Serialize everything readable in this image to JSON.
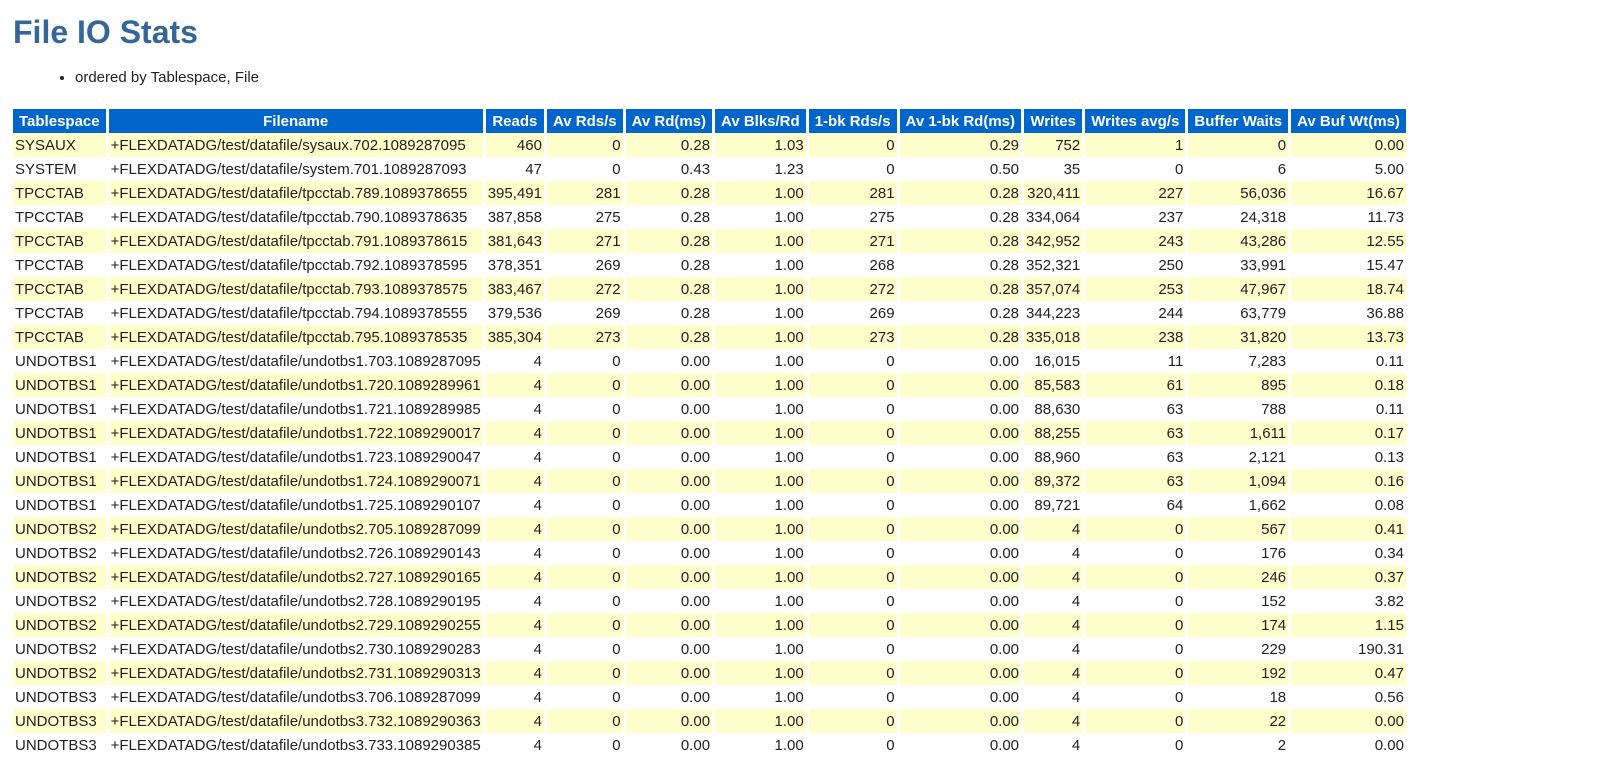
{
  "title": "File IO Stats",
  "notes": [
    "ordered by Tablespace, File"
  ],
  "columns": [
    "Tablespace",
    "Filename",
    "Reads",
    "Av Rds/s",
    "Av Rd(ms)",
    "Av Blks/Rd",
    "1-bk Rds/s",
    "Av 1-bk Rd(ms)",
    "Writes",
    "Writes avg/s",
    "Buffer Waits",
    "Av Buf Wt(ms)"
  ],
  "rows": [
    [
      "SYSAUX",
      "+FLEXDATADG/test/datafile/sysaux.702.1089287095",
      "460",
      "0",
      "0.28",
      "1.03",
      "0",
      "0.29",
      "752",
      "1",
      "0",
      "0.00"
    ],
    [
      "SYSTEM",
      "+FLEXDATADG/test/datafile/system.701.1089287093",
      "47",
      "0",
      "0.43",
      "1.23",
      "0",
      "0.50",
      "35",
      "0",
      "6",
      "5.00"
    ],
    [
      "TPCCTAB",
      "+FLEXDATADG/test/datafile/tpcctab.789.1089378655",
      "395,491",
      "281",
      "0.28",
      "1.00",
      "281",
      "0.28",
      "320,411",
      "227",
      "56,036",
      "16.67"
    ],
    [
      "TPCCTAB",
      "+FLEXDATADG/test/datafile/tpcctab.790.1089378635",
      "387,858",
      "275",
      "0.28",
      "1.00",
      "275",
      "0.28",
      "334,064",
      "237",
      "24,318",
      "11.73"
    ],
    [
      "TPCCTAB",
      "+FLEXDATADG/test/datafile/tpcctab.791.1089378615",
      "381,643",
      "271",
      "0.28",
      "1.00",
      "271",
      "0.28",
      "342,952",
      "243",
      "43,286",
      "12.55"
    ],
    [
      "TPCCTAB",
      "+FLEXDATADG/test/datafile/tpcctab.792.1089378595",
      "378,351",
      "269",
      "0.28",
      "1.00",
      "268",
      "0.28",
      "352,321",
      "250",
      "33,991",
      "15.47"
    ],
    [
      "TPCCTAB",
      "+FLEXDATADG/test/datafile/tpcctab.793.1089378575",
      "383,467",
      "272",
      "0.28",
      "1.00",
      "272",
      "0.28",
      "357,074",
      "253",
      "47,967",
      "18.74"
    ],
    [
      "TPCCTAB",
      "+FLEXDATADG/test/datafile/tpcctab.794.1089378555",
      "379,536",
      "269",
      "0.28",
      "1.00",
      "269",
      "0.28",
      "344,223",
      "244",
      "63,779",
      "36.88"
    ],
    [
      "TPCCTAB",
      "+FLEXDATADG/test/datafile/tpcctab.795.1089378535",
      "385,304",
      "273",
      "0.28",
      "1.00",
      "273",
      "0.28",
      "335,018",
      "238",
      "31,820",
      "13.73"
    ],
    [
      "UNDOTBS1",
      "+FLEXDATADG/test/datafile/undotbs1.703.1089287095",
      "4",
      "0",
      "0.00",
      "1.00",
      "0",
      "0.00",
      "16,015",
      "11",
      "7,283",
      "0.11"
    ],
    [
      "UNDOTBS1",
      "+FLEXDATADG/test/datafile/undotbs1.720.1089289961",
      "4",
      "0",
      "0.00",
      "1.00",
      "0",
      "0.00",
      "85,583",
      "61",
      "895",
      "0.18"
    ],
    [
      "UNDOTBS1",
      "+FLEXDATADG/test/datafile/undotbs1.721.1089289985",
      "4",
      "0",
      "0.00",
      "1.00",
      "0",
      "0.00",
      "88,630",
      "63",
      "788",
      "0.11"
    ],
    [
      "UNDOTBS1",
      "+FLEXDATADG/test/datafile/undotbs1.722.1089290017",
      "4",
      "0",
      "0.00",
      "1.00",
      "0",
      "0.00",
      "88,255",
      "63",
      "1,611",
      "0.17"
    ],
    [
      "UNDOTBS1",
      "+FLEXDATADG/test/datafile/undotbs1.723.1089290047",
      "4",
      "0",
      "0.00",
      "1.00",
      "0",
      "0.00",
      "88,960",
      "63",
      "2,121",
      "0.13"
    ],
    [
      "UNDOTBS1",
      "+FLEXDATADG/test/datafile/undotbs1.724.1089290071",
      "4",
      "0",
      "0.00",
      "1.00",
      "0",
      "0.00",
      "89,372",
      "63",
      "1,094",
      "0.16"
    ],
    [
      "UNDOTBS1",
      "+FLEXDATADG/test/datafile/undotbs1.725.1089290107",
      "4",
      "0",
      "0.00",
      "1.00",
      "0",
      "0.00",
      "89,721",
      "64",
      "1,662",
      "0.08"
    ],
    [
      "UNDOTBS2",
      "+FLEXDATADG/test/datafile/undotbs2.705.1089287099",
      "4",
      "0",
      "0.00",
      "1.00",
      "0",
      "0.00",
      "4",
      "0",
      "567",
      "0.41"
    ],
    [
      "UNDOTBS2",
      "+FLEXDATADG/test/datafile/undotbs2.726.1089290143",
      "4",
      "0",
      "0.00",
      "1.00",
      "0",
      "0.00",
      "4",
      "0",
      "176",
      "0.34"
    ],
    [
      "UNDOTBS2",
      "+FLEXDATADG/test/datafile/undotbs2.727.1089290165",
      "4",
      "0",
      "0.00",
      "1.00",
      "0",
      "0.00",
      "4",
      "0",
      "246",
      "0.37"
    ],
    [
      "UNDOTBS2",
      "+FLEXDATADG/test/datafile/undotbs2.728.1089290195",
      "4",
      "0",
      "0.00",
      "1.00",
      "0",
      "0.00",
      "4",
      "0",
      "152",
      "3.82"
    ],
    [
      "UNDOTBS2",
      "+FLEXDATADG/test/datafile/undotbs2.729.1089290255",
      "4",
      "0",
      "0.00",
      "1.00",
      "0",
      "0.00",
      "4",
      "0",
      "174",
      "1.15"
    ],
    [
      "UNDOTBS2",
      "+FLEXDATADG/test/datafile/undotbs2.730.1089290283",
      "4",
      "0",
      "0.00",
      "1.00",
      "0",
      "0.00",
      "4",
      "0",
      "229",
      "190.31"
    ],
    [
      "UNDOTBS2",
      "+FLEXDATADG/test/datafile/undotbs2.731.1089290313",
      "4",
      "0",
      "0.00",
      "1.00",
      "0",
      "0.00",
      "4",
      "0",
      "192",
      "0.47"
    ],
    [
      "UNDOTBS3",
      "+FLEXDATADG/test/datafile/undotbs3.706.1089287099",
      "4",
      "0",
      "0.00",
      "1.00",
      "0",
      "0.00",
      "4",
      "0",
      "18",
      "0.56"
    ],
    [
      "UNDOTBS3",
      "+FLEXDATADG/test/datafile/undotbs3.732.1089290363",
      "4",
      "0",
      "0.00",
      "1.00",
      "0",
      "0.00",
      "4",
      "0",
      "22",
      "0.00"
    ],
    [
      "UNDOTBS3",
      "+FLEXDATADG/test/datafile/undotbs3.733.1089290385",
      "4",
      "0",
      "0.00",
      "1.00",
      "0",
      "0.00",
      "4",
      "0",
      "2",
      "0.00"
    ]
  ],
  "colors": {
    "title": "#336699",
    "header_bg": "#0066cc",
    "header_text": "#ffffff",
    "row_alt_bg": "#ffffcc",
    "row_bg": "#ffffff"
  }
}
